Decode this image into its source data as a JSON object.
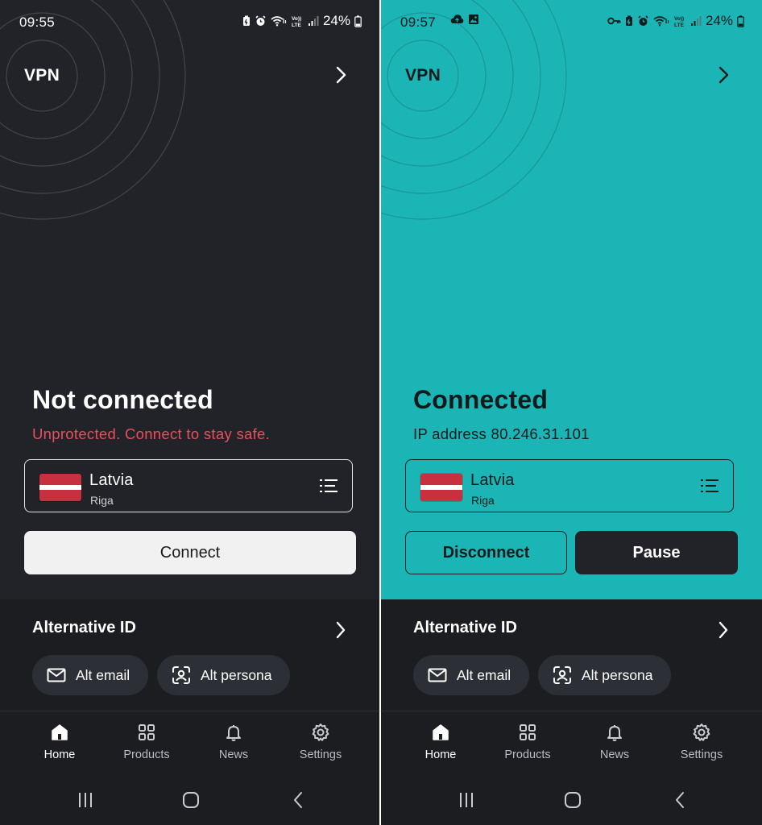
{
  "screens": {
    "left": {
      "status_bar": {
        "time": "09:55",
        "battery": "24%"
      },
      "header": {
        "title": "VPN"
      },
      "connection": {
        "title": "Not connected",
        "subtitle": "Unprotected. Connect to stay safe."
      },
      "location": {
        "country": "Latvia",
        "city": "Riga"
      },
      "buttons": {
        "connect": "Connect"
      },
      "alt_id": {
        "title": "Alternative ID",
        "email_chip": "Alt email",
        "persona_chip": "Alt persona"
      },
      "nav": {
        "home": "Home",
        "products": "Products",
        "news": "News",
        "settings": "Settings"
      },
      "theme": {
        "background": "#212328",
        "status_color": "#e8505b"
      }
    },
    "right": {
      "status_bar": {
        "time": "09:57",
        "battery": "24%"
      },
      "header": {
        "title": "VPN"
      },
      "connection": {
        "title": "Connected",
        "subtitle": "IP address 80.246.31.101"
      },
      "location": {
        "country": "Latvia",
        "city": "Riga"
      },
      "buttons": {
        "disconnect": "Disconnect",
        "pause": "Pause"
      },
      "alt_id": {
        "title": "Alternative ID",
        "email_chip": "Alt email",
        "persona_chip": "Alt persona"
      },
      "nav": {
        "home": "Home",
        "products": "Products",
        "news": "News",
        "settings": "Settings"
      },
      "theme": {
        "background": "#1cb5b5"
      }
    }
  },
  "icons": [
    "battery-saver-icon",
    "alarm-icon",
    "wifi-icon",
    "volte-icon",
    "signal-icon",
    "battery-icon",
    "cloud-icon",
    "image-icon",
    "key-icon",
    "chevron-right-icon",
    "list-icon",
    "mail-icon",
    "persona-icon",
    "home-icon",
    "grid-icon",
    "bell-icon",
    "gear-icon",
    "recents-icon",
    "home-circle-icon",
    "back-icon"
  ],
  "active_tab": "Home"
}
